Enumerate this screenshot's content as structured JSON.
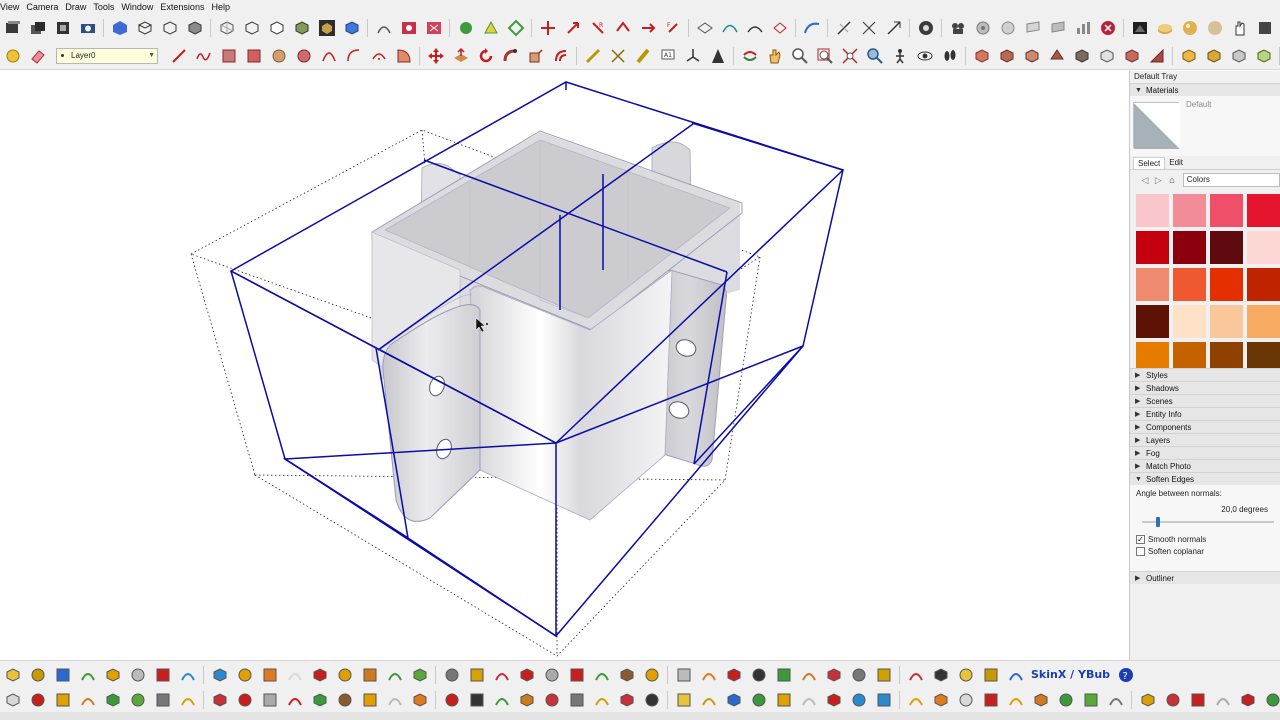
{
  "menu": [
    "View",
    "Camera",
    "Draw",
    "Tools",
    "Window",
    "Extensions",
    "Help"
  ],
  "layer": {
    "current": "Layer0"
  },
  "skin_badge": "SkinX / YBub",
  "tray": {
    "title": "Default Tray",
    "materials": {
      "header": "Materials",
      "material_name": "Default",
      "tabs": [
        "Select",
        "Edit"
      ],
      "collection": "Colors",
      "swatches": [
        "#f8c6cb",
        "#f28c99",
        "#ef4f68",
        "#e4142e",
        "#c4000f",
        "#8c000e",
        "#5e0a0e",
        "#fcd7d3",
        "#f08a6e",
        "#f0582f",
        "#e43000",
        "#c02300",
        "#5e1205",
        "#fde2c8",
        "#f9c79a",
        "#f6aa62",
        "#e57c00",
        "#c46200",
        "#8e4100",
        "#6a3605"
      ]
    },
    "panels": [
      "Styles",
      "Shadows",
      "Scenes",
      "Entity Info",
      "Components",
      "Layers",
      "Fog",
      "Match Photo"
    ],
    "soften_edges": {
      "header": "Soften Edges",
      "angle_label": "Angle between normals:",
      "angle_value": "20,0  degrees",
      "angle": 20.0,
      "smooth_normals": "Smooth normals",
      "smooth_checked": true,
      "soften_coplanar": "Soften coplanar",
      "coplanar_checked": false
    },
    "outliner": "Outliner"
  }
}
